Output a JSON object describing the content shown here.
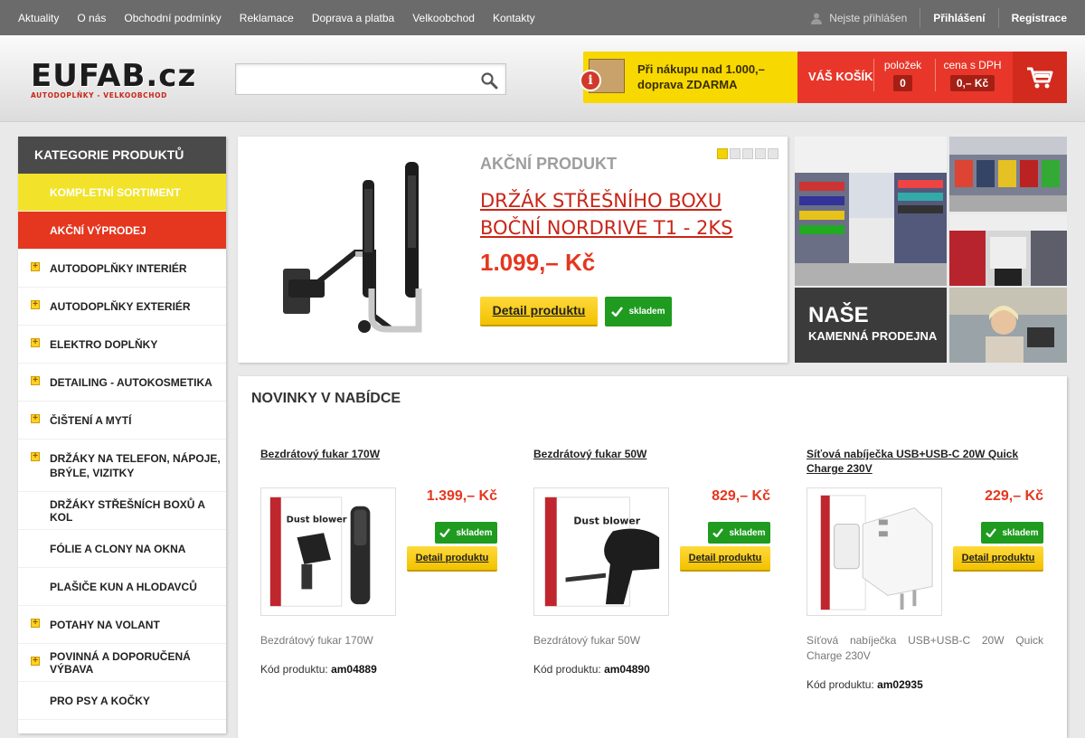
{
  "topnav": {
    "items": [
      "Aktuality",
      "O nás",
      "Obchodní podmínky",
      "Reklamace",
      "Doprava a platba",
      "Velkoobchod",
      "Kontakty"
    ]
  },
  "user": {
    "status": "Nejste přihlášen",
    "login": "Přihlášení",
    "register": "Registrace",
    "icon": "user-icon"
  },
  "logo": {
    "main": "EUFAB",
    "tld": ".cz",
    "sub": "AUTODOPLŇKY - VELKOOBCHOD"
  },
  "search": {
    "value": "",
    "placeholder": "",
    "icon": "search-icon"
  },
  "promo": {
    "line1": "Při nákupu nad 1.000,–",
    "line2": "doprava ZDARMA",
    "icon": "info-icon"
  },
  "cart": {
    "label": "VÁŠ KOŠÍK",
    "items_label": "položek",
    "items_value": "0",
    "price_label": "cena s DPH",
    "price_value": "0,– Kč",
    "icon": "cart-icon",
    "accent": "#e8372a"
  },
  "sidebar": {
    "title": "KATEGORIE PRODUKTŮ",
    "items": [
      {
        "label": "KOMPLETNÍ SORTIMENT",
        "style": "y",
        "plus": false
      },
      {
        "label": "AKČNÍ VÝPRODEJ",
        "style": "r",
        "plus": false
      },
      {
        "label": "AUTODOPLŇKY INTERIÉR",
        "style": "",
        "plus": true
      },
      {
        "label": "AUTODOPLŇKY EXTERIÉR",
        "style": "",
        "plus": true
      },
      {
        "label": "ELEKTRO DOPLŇKY",
        "style": "",
        "plus": true
      },
      {
        "label": "DETAILING - AUTOKOSMETIKA",
        "style": "",
        "plus": true
      },
      {
        "label": "ČIŠTENÍ A MYTÍ",
        "style": "",
        "plus": true
      },
      {
        "label": "DRŽÁKY NA TELEFON, NÁPOJE, BRÝLE, VIZITKY",
        "style": "tall",
        "plus": true
      },
      {
        "label": "DRŽÁKY STŘEŠNÍCH BOXŮ A KOL",
        "style": "",
        "plus": false
      },
      {
        "label": "FÓLIE A CLONY NA OKNA",
        "style": "",
        "plus": false
      },
      {
        "label": "PLAŠIČE KUN A HLODAVCŮ",
        "style": "",
        "plus": false
      },
      {
        "label": "POTAHY NA VOLANT",
        "style": "",
        "plus": true
      },
      {
        "label": "POVINNÁ A DOPORUČENÁ VÝBAVA",
        "style": "",
        "plus": true
      },
      {
        "label": "PRO PSY A KOČKY",
        "style": "",
        "plus": false
      }
    ]
  },
  "banner": {
    "kicker": "AKČNÍ PRODUKT",
    "title": "DRŽÁK STŘEŠNÍHO BOXU BOČNÍ NORDRIVE T1 - 2KS",
    "price": "1.099,– Kč",
    "detail": "Detail produktu",
    "stock": "skladem",
    "slides": 5,
    "active_slide": 1
  },
  "store": {
    "line1": "NAŠE",
    "line2": "KAMENNÁ PRODEJNA"
  },
  "news": {
    "heading": "NOVINKY V NABÍDCE",
    "code_label": "Kód produktu:",
    "products": [
      {
        "title": "Bezdrátový fukar 170W",
        "price": "1.399,– Kč",
        "stock": "skladem",
        "detail": "Detail produktu",
        "desc": "Bezdrátový fukar 170W",
        "code": "am04889"
      },
      {
        "title": "Bezdrátový fukar 50W",
        "price": "829,– Kč",
        "stock": "skladem",
        "detail": "Detail produktu",
        "desc": "Bezdrátový fukar 50W",
        "code": "am04890"
      },
      {
        "title": "Síťová nabíječka USB+USB-C 20W Quick Charge 230V",
        "price": "229,– Kč",
        "stock": "skladem",
        "detail": "Detail produktu",
        "desc": "Síťová nabíječka USB+USB-C 20W Quick Charge 230V",
        "code": "am02935"
      }
    ]
  }
}
